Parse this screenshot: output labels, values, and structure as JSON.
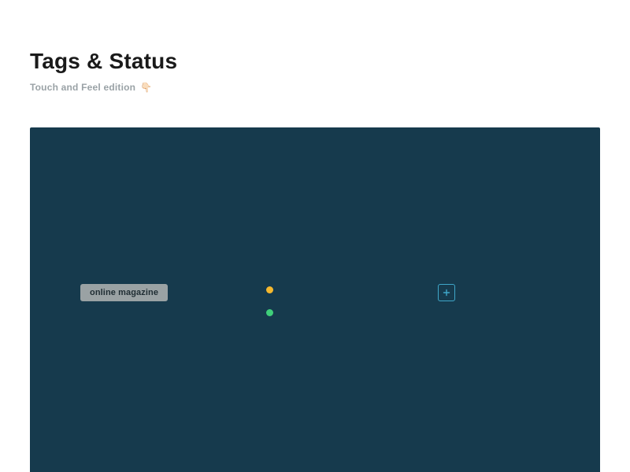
{
  "header": {
    "title": "Tags & Status",
    "subtitle": "Touch and Feel edition",
    "subtitle_emoji": "👇🏻"
  },
  "panel": {
    "bg": "#163a4d",
    "tag": {
      "label": "online magazine"
    },
    "status": {
      "pending_color": "#f5b82e",
      "ok_color": "#3fcf7a"
    },
    "add": {
      "stroke": "#3fa7c9",
      "plus_stroke": "#3fa7c9"
    }
  }
}
